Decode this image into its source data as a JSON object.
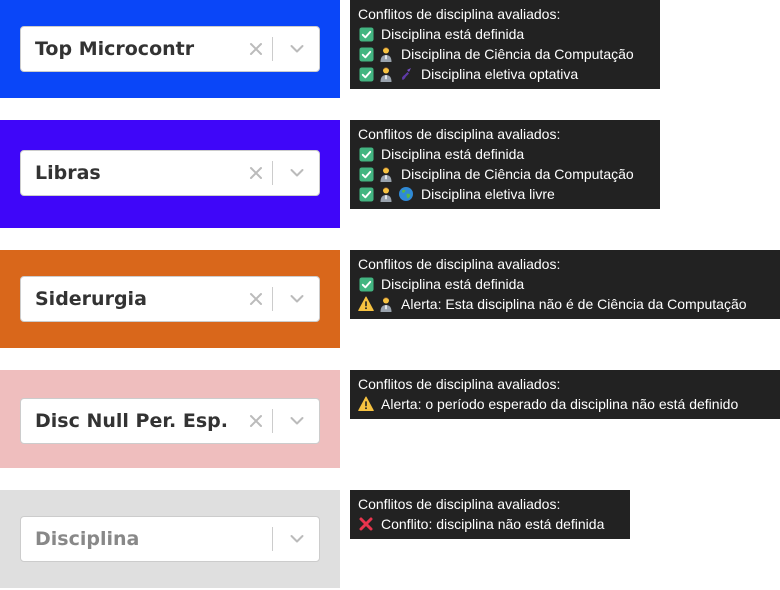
{
  "colors": {
    "panel_1": "#0a46f8",
    "panel_2": "#3f06f9",
    "panel_3": "#d9671b",
    "panel_4": "#efbebe",
    "panel_5": "#dfdfdf",
    "tooltip_bg": "#222222",
    "check_green": "#43b581",
    "warning_yellow": "#f6c241",
    "error_red": "#e8344d"
  },
  "panels": [
    {
      "value": "Top Microcontr",
      "tooltip": {
        "title": "Conflitos de disciplina avaliados:",
        "lines": [
          {
            "icons": [
              "check-icon"
            ],
            "text": "Disciplina está definida"
          },
          {
            "icons": [
              "check-icon",
              "teacher-icon"
            ],
            "text": "Disciplina de Ciência da Computação"
          },
          {
            "icons": [
              "check-icon",
              "teacher-icon",
              "brush-icon"
            ],
            "text": "Disciplina eletiva optativa"
          }
        ]
      }
    },
    {
      "value": "Libras",
      "tooltip": {
        "title": "Conflitos de disciplina avaliados:",
        "lines": [
          {
            "icons": [
              "check-icon"
            ],
            "text": "Disciplina está definida"
          },
          {
            "icons": [
              "check-icon",
              "teacher-icon"
            ],
            "text": "Disciplina de Ciência da Computação"
          },
          {
            "icons": [
              "check-icon",
              "teacher-icon",
              "globe-icon"
            ],
            "text": "Disciplina eletiva livre"
          }
        ]
      }
    },
    {
      "value": "Siderurgia",
      "tooltip": {
        "title": "Conflitos de disciplina avaliados:",
        "lines": [
          {
            "icons": [
              "check-icon"
            ],
            "text": "Disciplina está definida"
          },
          {
            "icons": [
              "warning-icon",
              "teacher-icon"
            ],
            "text": "Alerta: Esta disciplina não é de Ciência da Computação"
          }
        ]
      }
    },
    {
      "value": "Disc Null Per. Esp.",
      "tooltip": {
        "title": "Conflitos de disciplina avaliados:",
        "lines": [
          {
            "icons": [
              "warning-icon"
            ],
            "text": "Alerta: o período esperado da disciplina não está definido"
          }
        ]
      }
    },
    {
      "placeholder": "Disciplina",
      "tooltip": {
        "title": "Conflitos de disciplina avaliados:",
        "lines": [
          {
            "icons": [
              "cross-icon"
            ],
            "text": "Conflito: disciplina não está definida"
          }
        ]
      }
    }
  ]
}
